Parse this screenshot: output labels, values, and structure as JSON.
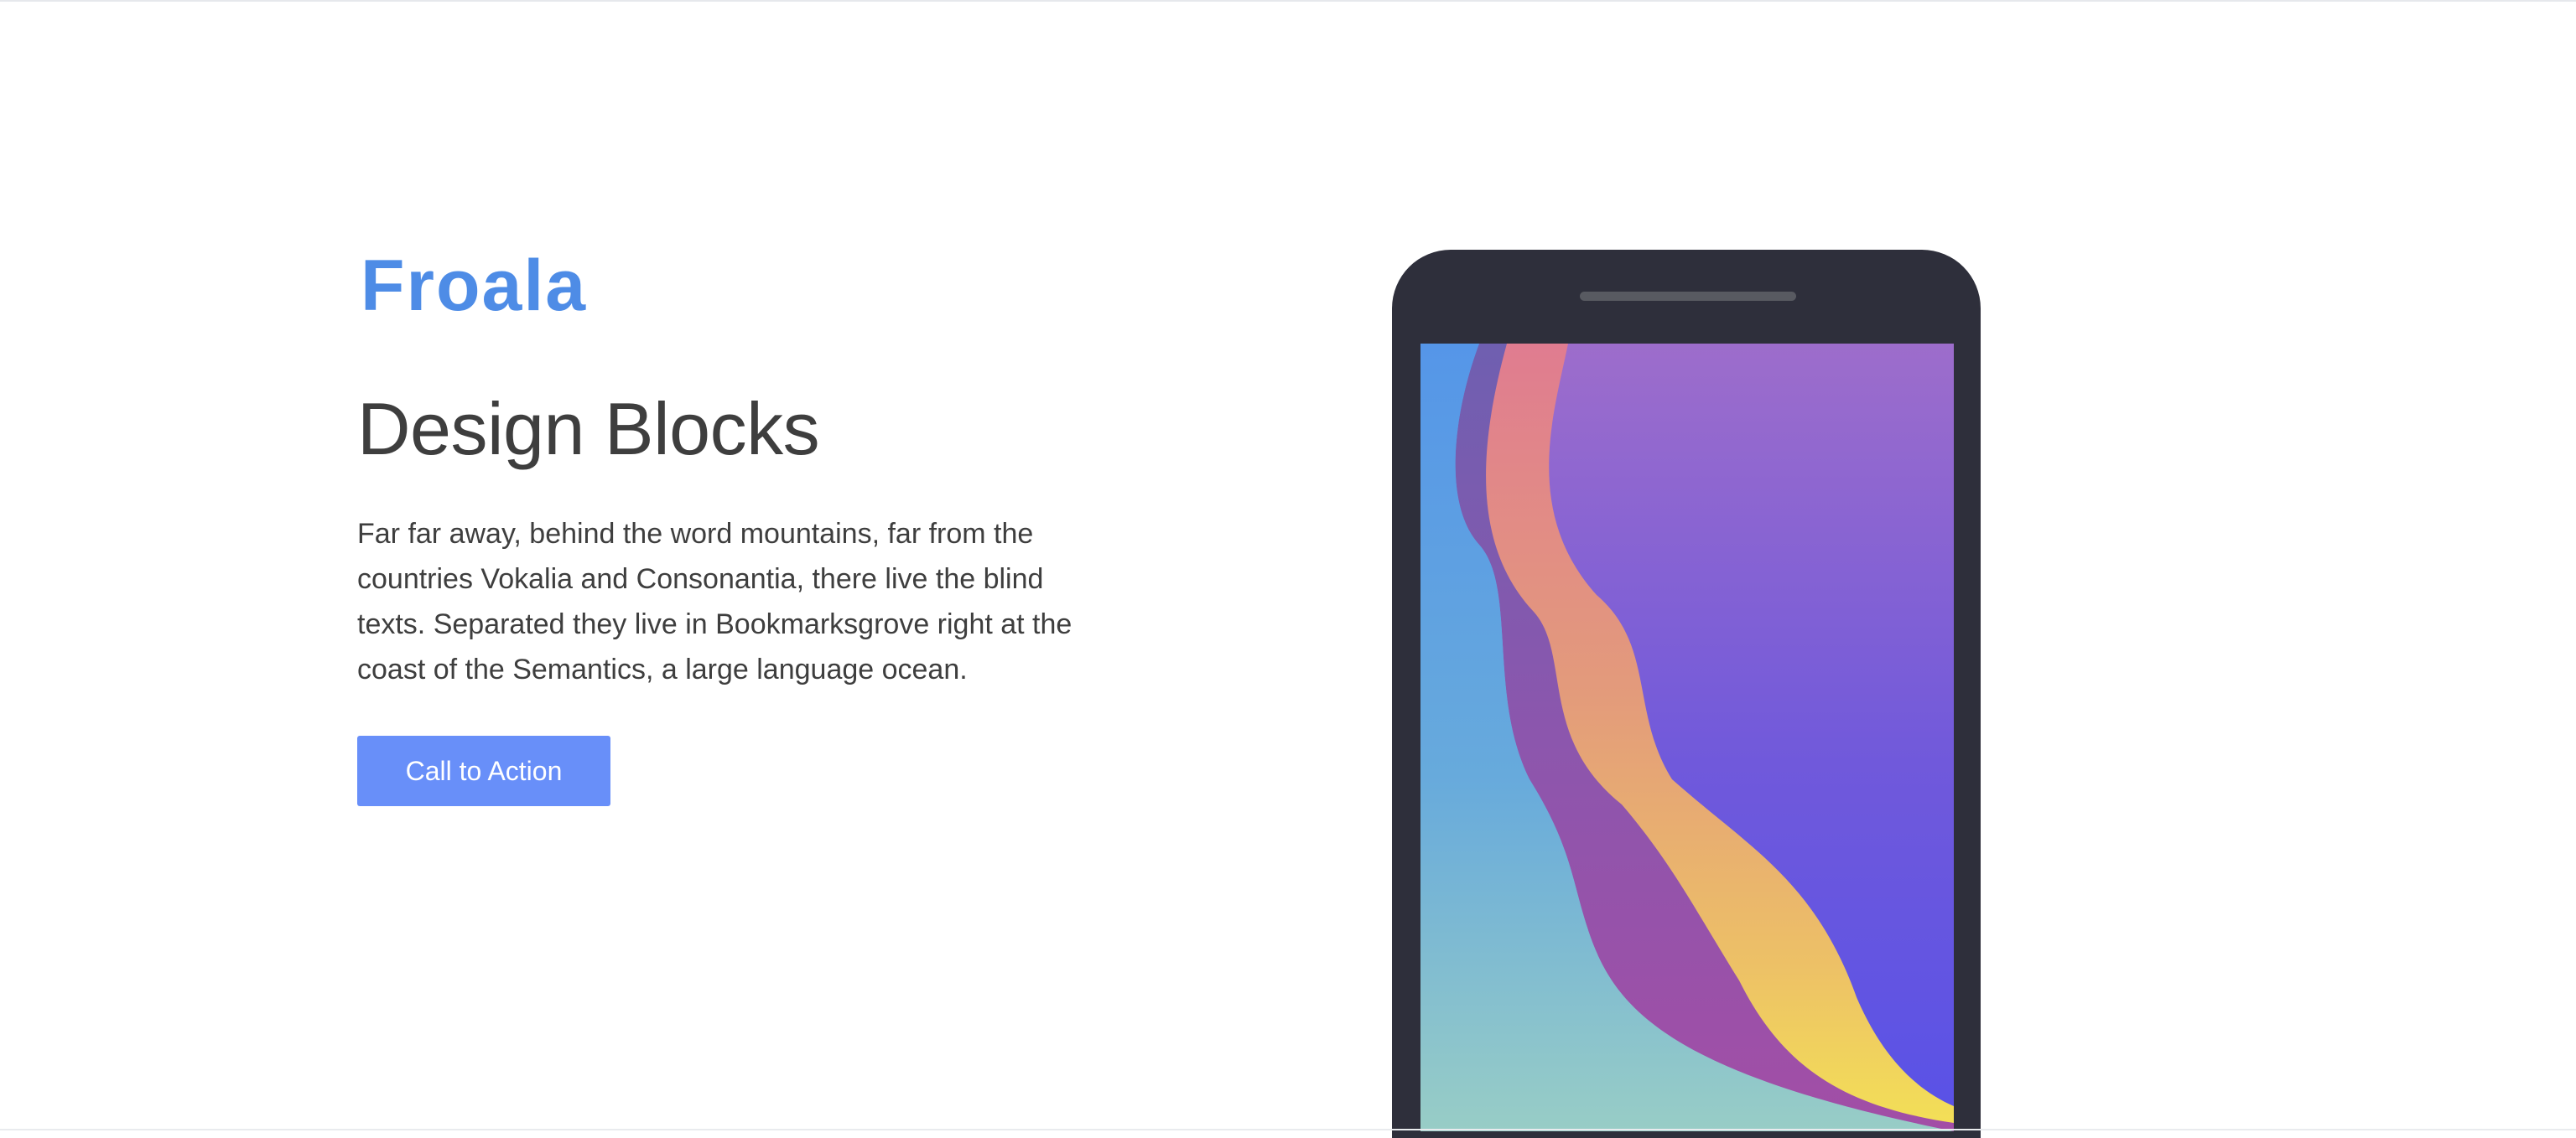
{
  "brand": {
    "logo_text": "Froala",
    "logo_color": "#4e8ce6"
  },
  "hero": {
    "title": "Design Blocks",
    "description": "Far far away, behind the word mountains, far from the countries Vokalia and Consonantia, there live the blind texts. Separated they live in Bookmarksgrove right at the coast of the Semantics, a large language ocean.",
    "cta_label": "Call to Action"
  },
  "colors": {
    "accent": "#688ff9",
    "text": "#3e3e3e",
    "phone_body": "#2e2f3b",
    "screen_blue": "#5b97e6",
    "screen_purple": "#9e6dcd",
    "screen_coral": "#e07c88",
    "screen_yellow": "#f2d95a"
  },
  "icons": {
    "phone": "smartphone-mockup",
    "speaker": "phone-speaker-grille"
  }
}
